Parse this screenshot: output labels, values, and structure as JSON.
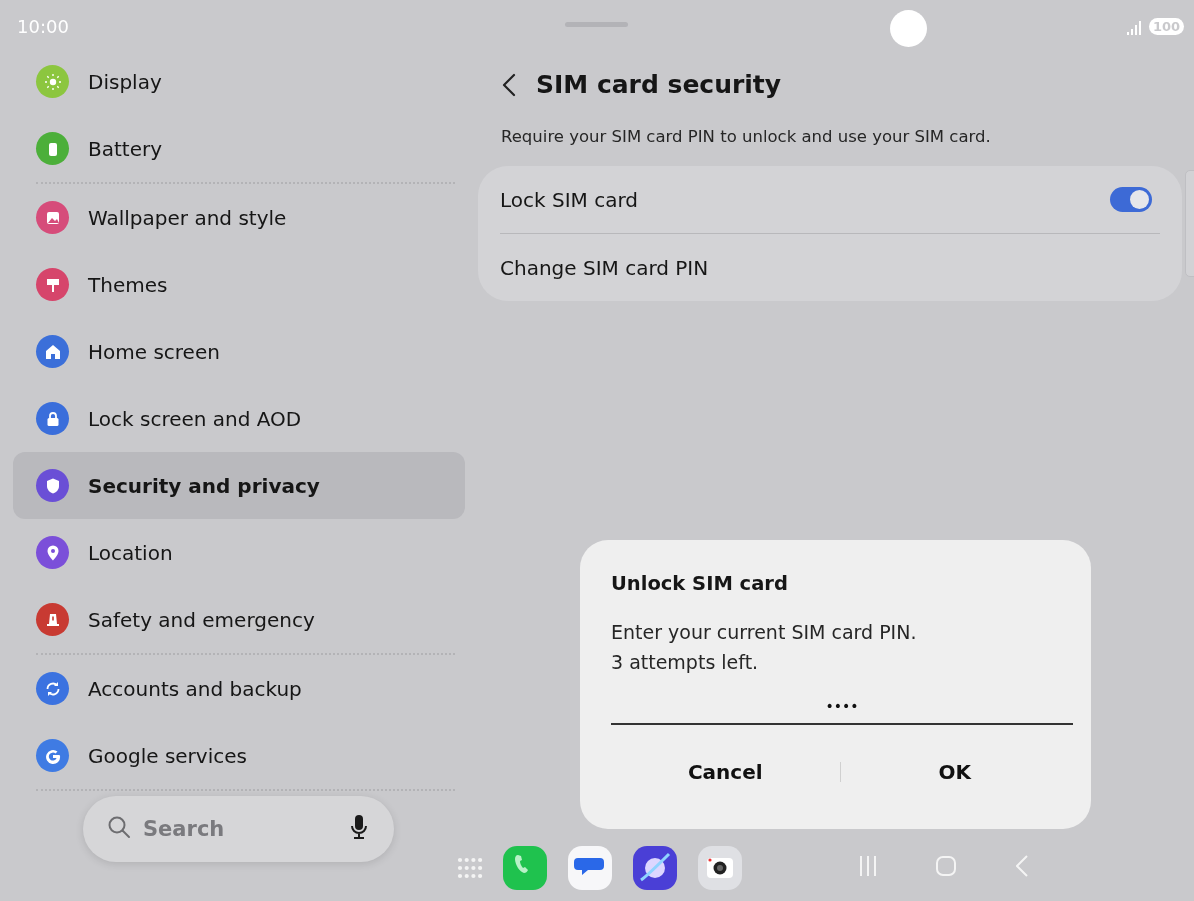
{
  "status_bar": {
    "time": "10:00",
    "battery": "100"
  },
  "sidebar": {
    "items": [
      {
        "label": "Display",
        "color": "#8cc63f",
        "selected": false,
        "group_end": false
      },
      {
        "label": "Battery",
        "color": "#4caf3a",
        "selected": false,
        "group_end": true
      },
      {
        "label": "Wallpaper and style",
        "color": "#d64c7a",
        "selected": false,
        "group_end": false
      },
      {
        "label": "Themes",
        "color": "#d6456b",
        "selected": false,
        "group_end": false
      },
      {
        "label": "Home screen",
        "color": "#3b6fd9",
        "selected": false,
        "group_end": false
      },
      {
        "label": "Lock screen and AOD",
        "color": "#3a6edb",
        "selected": false,
        "group_end": false
      },
      {
        "label": "Security and privacy",
        "color": "#6a4fd6",
        "selected": true,
        "group_end": false
      },
      {
        "label": "Location",
        "color": "#7b4fd9",
        "selected": false,
        "group_end": false
      },
      {
        "label": "Safety and emergency",
        "color": "#c83a32",
        "selected": false,
        "group_end": true
      },
      {
        "label": "Accounts and backup",
        "color": "#3b72e0",
        "selected": false,
        "group_end": false
      },
      {
        "label": "Google services",
        "color": "#3f7be3",
        "selected": false,
        "group_end": true
      }
    ]
  },
  "search": {
    "placeholder": "Search"
  },
  "page": {
    "title": "SIM card security",
    "description": "Require your SIM card PIN to unlock and use your SIM card.",
    "rows": [
      {
        "label": "Lock SIM card",
        "kind": "switch",
        "on": true
      },
      {
        "label": "Change SIM card PIN",
        "kind": "link"
      }
    ]
  },
  "dialog": {
    "title": "Unlock SIM card",
    "message": [
      "Enter your current SIM card PIN.",
      "3 attempts left."
    ],
    "pin": "••••",
    "buttons": [
      "Cancel",
      "OK"
    ]
  }
}
